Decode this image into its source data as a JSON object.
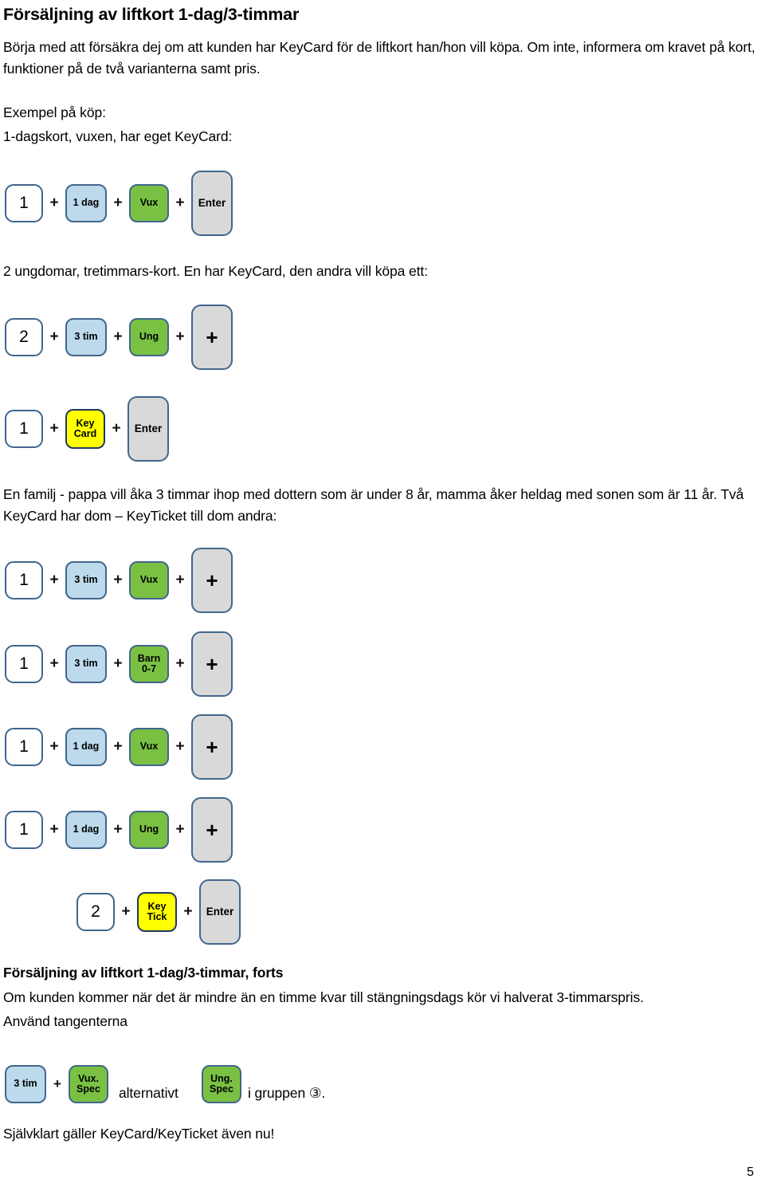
{
  "document": {
    "title": "Försäljning av liftkort 1-dag/3-timmar",
    "intro_paragraph": "Börja med att försäkra dej om att kunden har KeyCard för de liftkort han/hon vill köpa. Om inte, informera om kravet på kort, funktioner på de två varianterna samt pris.",
    "example_label": "Exempel på köp:",
    "example_1_caption": "1-dagskort, vuxen, har eget KeyCard:",
    "example_2_caption": "2 ungdomar, tretimmars-kort. En har KeyCard, den andra vill köpa ett:",
    "example_3_caption": "En familj - pappa vill åka 3 timmar ihop med dottern som är under 8 år, mamma åker heldag med sonen som är 11 år.  Två KeyCard  har dom – KeyTicket till dom andra:",
    "continuation_title": "Försäljning av liftkort 1-dag/3-timmar, forts",
    "continuation_paragraph": "Om kunden kommer när det är mindre än en timme kvar till stängningsdags kör vi halverat 3-timmarspris.",
    "use_keys_label": "Använd tangenterna",
    "alternatively_label": "alternativt",
    "group_label": "i gruppen ③.",
    "footer_note": "Självklart gäller KeyCard/KeyTicket även nu!",
    "page_number": "5"
  },
  "colors": {
    "key_border": "#41668c",
    "key_border_dark": "#1f3864",
    "key_white": "#ffffff",
    "key_blue": "#bdd9ec",
    "key_green": "#7ac143",
    "key_yellow": "#ffff00",
    "key_gray": "#d9d9d9",
    "text": "#000000"
  },
  "separators": {
    "plus": "+"
  },
  "key_sequences": [
    {
      "id": "seq-1-dag-vux-enter",
      "keys": [
        {
          "label": "1",
          "lines": [
            "1"
          ],
          "type": "num"
        },
        {
          "label": "1 dag",
          "lines": [
            "1 dag"
          ],
          "type": "blue"
        },
        {
          "label": "Vux",
          "lines": [
            "Vux"
          ],
          "type": "green"
        },
        {
          "label": "Enter",
          "lines": [
            "Enter"
          ],
          "type": "gray-tall"
        }
      ]
    },
    {
      "id": "seq-2-3tim-ung-plus",
      "keys": [
        {
          "label": "2",
          "lines": [
            "2"
          ],
          "type": "num"
        },
        {
          "label": "3 tim",
          "lines": [
            "3 tim"
          ],
          "type": "blue"
        },
        {
          "label": "Ung",
          "lines": [
            "Ung"
          ],
          "type": "green"
        },
        {
          "label": "+",
          "lines": [
            "+"
          ],
          "type": "gray-tall-plus"
        }
      ]
    },
    {
      "id": "seq-1-keycard-enter",
      "keys": [
        {
          "label": "1",
          "lines": [
            "1"
          ],
          "type": "num"
        },
        {
          "label": "Key Card",
          "lines": [
            "Key",
            "Card"
          ],
          "type": "yellow"
        },
        {
          "label": "Enter",
          "lines": [
            "Enter"
          ],
          "type": "gray-tall"
        }
      ]
    },
    {
      "id": "seq-1-3tim-vux-plus",
      "keys": [
        {
          "label": "1",
          "lines": [
            "1"
          ],
          "type": "num"
        },
        {
          "label": "3 tim",
          "lines": [
            "3 tim"
          ],
          "type": "blue"
        },
        {
          "label": "Vux",
          "lines": [
            "Vux"
          ],
          "type": "green"
        },
        {
          "label": "+",
          "lines": [
            "+"
          ],
          "type": "gray-tall-plus"
        }
      ]
    },
    {
      "id": "seq-1-3tim-barn-plus",
      "keys": [
        {
          "label": "1",
          "lines": [
            "1"
          ],
          "type": "num"
        },
        {
          "label": "3 tim",
          "lines": [
            "3 tim"
          ],
          "type": "blue"
        },
        {
          "label": "Barn 0-7",
          "lines": [
            "Barn",
            "0-7"
          ],
          "type": "green"
        },
        {
          "label": "+",
          "lines": [
            "+"
          ],
          "type": "gray-tall-plus"
        }
      ]
    },
    {
      "id": "seq-1-1dag-vux-plus",
      "keys": [
        {
          "label": "1",
          "lines": [
            "1"
          ],
          "type": "num"
        },
        {
          "label": "1 dag",
          "lines": [
            "1 dag"
          ],
          "type": "blue"
        },
        {
          "label": "Vux",
          "lines": [
            "Vux"
          ],
          "type": "green"
        },
        {
          "label": "+",
          "lines": [
            "+"
          ],
          "type": "gray-tall-plus"
        }
      ]
    },
    {
      "id": "seq-1-1dag-ung-plus",
      "keys": [
        {
          "label": "1",
          "lines": [
            "1"
          ],
          "type": "num"
        },
        {
          "label": "1 dag",
          "lines": [
            "1 dag"
          ],
          "type": "blue"
        },
        {
          "label": "Ung",
          "lines": [
            "Ung"
          ],
          "type": "green"
        },
        {
          "label": "+",
          "lines": [
            "+"
          ],
          "type": "gray-tall-plus"
        }
      ]
    },
    {
      "id": "seq-2-keytick-enter",
      "keys": [
        {
          "label": "2",
          "lines": [
            "2"
          ],
          "type": "num"
        },
        {
          "label": "Key Tick",
          "lines": [
            "Key",
            "Tick"
          ],
          "type": "yellow"
        },
        {
          "label": "Enter",
          "lines": [
            "Enter"
          ],
          "type": "gray-tall"
        }
      ]
    },
    {
      "id": "seq-3tim-vuxspec",
      "keys": [
        {
          "label": "3 tim",
          "lines": [
            "3 tim"
          ],
          "type": "blue"
        },
        {
          "label": "Vux. Spec",
          "lines": [
            "Vux.",
            "Spec"
          ],
          "type": "green"
        }
      ]
    },
    {
      "id": "seq-ungspec",
      "keys": [
        {
          "label": "Ung. Spec",
          "lines": [
            "Ung.",
            "Spec"
          ],
          "type": "green"
        }
      ]
    }
  ]
}
